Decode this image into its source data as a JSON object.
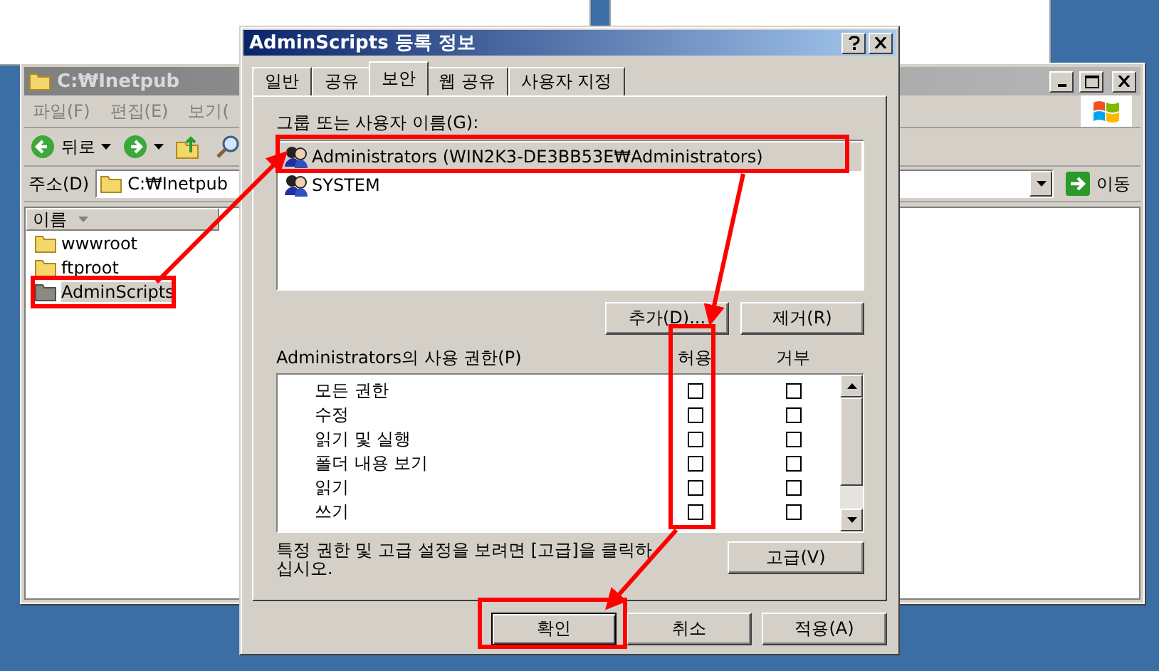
{
  "explorer": {
    "title": "C:₩Inetpub",
    "menu": [
      "파일(F)",
      "편집(E)",
      "보기("
    ],
    "toolbar": {
      "back_label": "뒤로"
    },
    "address": {
      "label": "주소(D)",
      "value": "C:₩Inetpub",
      "go_label": "이동"
    },
    "column_header": "이름",
    "items": [
      {
        "name": "wwwroot",
        "selected": false
      },
      {
        "name": "ftproot",
        "selected": false
      },
      {
        "name": "AdminScripts",
        "selected": true
      }
    ]
  },
  "dialog": {
    "title": "AdminScripts 등록 정보",
    "tabs": [
      {
        "label": "일반",
        "selected": false
      },
      {
        "label": "공유",
        "selected": false
      },
      {
        "label": "보안",
        "selected": true
      },
      {
        "label": "웹 공유",
        "selected": false
      },
      {
        "label": "사용자 지정",
        "selected": false
      }
    ],
    "users_label": "그룹 또는 사용자 이름(G):",
    "users": [
      {
        "name": "Administrators (WIN2K3-DE3BB53E₩Administrators)",
        "selected": true
      },
      {
        "name": "SYSTEM",
        "selected": false
      }
    ],
    "add_button": "추가(D)...",
    "remove_button": "제거(R)",
    "permissions_label": "Administrators의 사용 권한(P)",
    "allow_header": "허용",
    "deny_header": "거부",
    "permissions": [
      {
        "name": "모든 권한",
        "allow": false,
        "deny": false
      },
      {
        "name": "수정",
        "allow": false,
        "deny": false
      },
      {
        "name": "읽기 및 실행",
        "allow": false,
        "deny": false
      },
      {
        "name": "폴더 내용 보기",
        "allow": false,
        "deny": false
      },
      {
        "name": "읽기",
        "allow": false,
        "deny": false
      },
      {
        "name": "쓰기",
        "allow": false,
        "deny": false
      }
    ],
    "hint": "특정 권한 및 고급 설정을 보려면 [고급]을 클릭하 십시오.",
    "advanced_button": "고급(V)",
    "buttons": [
      {
        "label": "확인",
        "default": true
      },
      {
        "label": "취소",
        "default": false
      },
      {
        "label": "적용(A)",
        "default": false
      }
    ]
  }
}
